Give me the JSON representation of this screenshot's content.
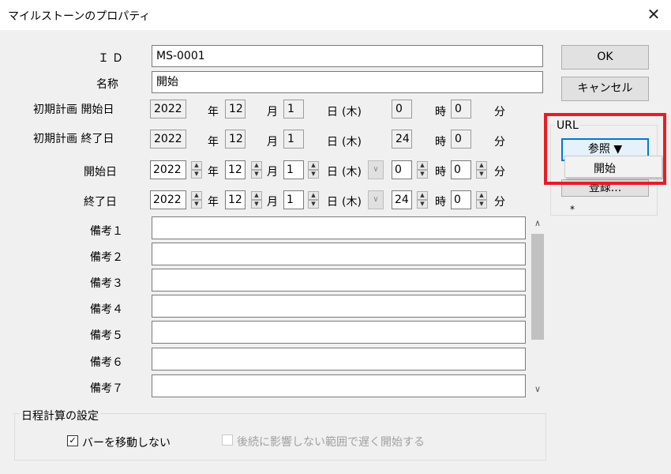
{
  "window": {
    "title": "マイルストーンのプロパティ"
  },
  "labels": {
    "id": "ＩＤ",
    "name": "名称",
    "plan_start": "初期計画 開始日",
    "plan_end": "初期計画 終了日",
    "start": "開始日",
    "end": "終了日"
  },
  "fields": {
    "id": "MS-0001",
    "name": "開始"
  },
  "units": {
    "year": "年",
    "month": "月",
    "day": "日",
    "hour": "時",
    "minute": "分"
  },
  "dates": {
    "plan_start": {
      "year": "2022",
      "month": "12",
      "day": "1",
      "weekday": "(木)",
      "hour": "0",
      "minute": "0"
    },
    "plan_end": {
      "year": "2022",
      "month": "12",
      "day": "1",
      "weekday": "(木)",
      "hour": "24",
      "minute": "0"
    },
    "start": {
      "year": "2022",
      "month": "12",
      "day": "1",
      "weekday": "(木)",
      "hour": "0",
      "minute": "0"
    },
    "end": {
      "year": "2022",
      "month": "12",
      "day": "1",
      "weekday": "(木)",
      "hour": "24",
      "minute": "0"
    }
  },
  "memos": [
    "備考１",
    "備考２",
    "備考３",
    "備考４",
    "備考５",
    "備考６",
    "備考７"
  ],
  "buttons": {
    "ok": "OK",
    "cancel": "キャンセル",
    "browse": "参照 ▼",
    "register": "登録..."
  },
  "url_group": {
    "label": "URL",
    "asterisk": "*"
  },
  "dropdown": {
    "items": [
      "開始"
    ]
  },
  "schedule": {
    "label": "日程計算の設定",
    "no_move": {
      "label": "バーを移動しない",
      "checked": true
    },
    "delay": {
      "label": "後続に影響しない範囲で遅く開始する",
      "checked": false,
      "enabled": false
    }
  },
  "colors": {
    "highlight": "#e81c24",
    "focus": "#0078d7"
  }
}
